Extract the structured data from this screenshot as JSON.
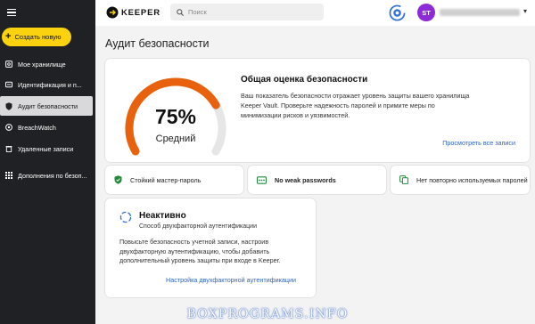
{
  "sidebar": {
    "create_label": "Создать новую",
    "items": [
      {
        "label": "Мое хранилище",
        "icon": "vault-icon"
      },
      {
        "label": "Идентификация и п...",
        "icon": "id-card-icon"
      },
      {
        "label": "Аудит безопасности",
        "icon": "shield-icon",
        "active": true
      },
      {
        "label": "BreachWatch",
        "icon": "breachwatch-icon"
      },
      {
        "label": "Удаленные записи",
        "icon": "trash-icon"
      },
      {
        "label": "Дополнения по безоп...",
        "icon": "grid-icon"
      }
    ]
  },
  "topbar": {
    "logo": "KEEPER",
    "search_placeholder": "Поиск",
    "avatar_initials": "ST"
  },
  "page": {
    "title": "Аудит безопасности"
  },
  "score": {
    "percent": "75%",
    "percent_value": 0.75,
    "level": "Средний",
    "title": "Общая оценка безопасности",
    "description": "Ваш показатель безопасности отражает уровень защиты вашего хранилища Keeper Vault. Проверьте надежность паролей и примите меры по минимизации рисков и уязвимостей.",
    "view_all": "Просмотреть все записи",
    "gauge_color": "#e8620d",
    "track_color": "#e6e6e6"
  },
  "checks": [
    {
      "label": "Стойкий мастер-пароль",
      "icon": "shield-check-icon",
      "color": "#1f8a3a"
    },
    {
      "label": "No weak passwords",
      "icon": "password-icon",
      "color": "#1f8a3a"
    },
    {
      "label": "Нет повторно используемых паролей",
      "icon": "copy-icon",
      "color": "#1f8a3a"
    }
  ],
  "twofa": {
    "status": "Неактивно",
    "subtitle": "Способ двухфакторной аутентификации",
    "description": "Повысьте безопасность учетной записи, настроив двухфакторную аутентификацию, чтобы добавить дополнительный уровень защиты при входе в Keeper.",
    "link": "Настройка двухфакторной аутентификации"
  },
  "watermark": "BOXPROGRAMS.INFO",
  "colors": {
    "accent_yellow": "#fbd210",
    "link_blue": "#2b64c4",
    "sidebar_bg": "#202124",
    "avatar_purple": "#8d2bd6"
  }
}
